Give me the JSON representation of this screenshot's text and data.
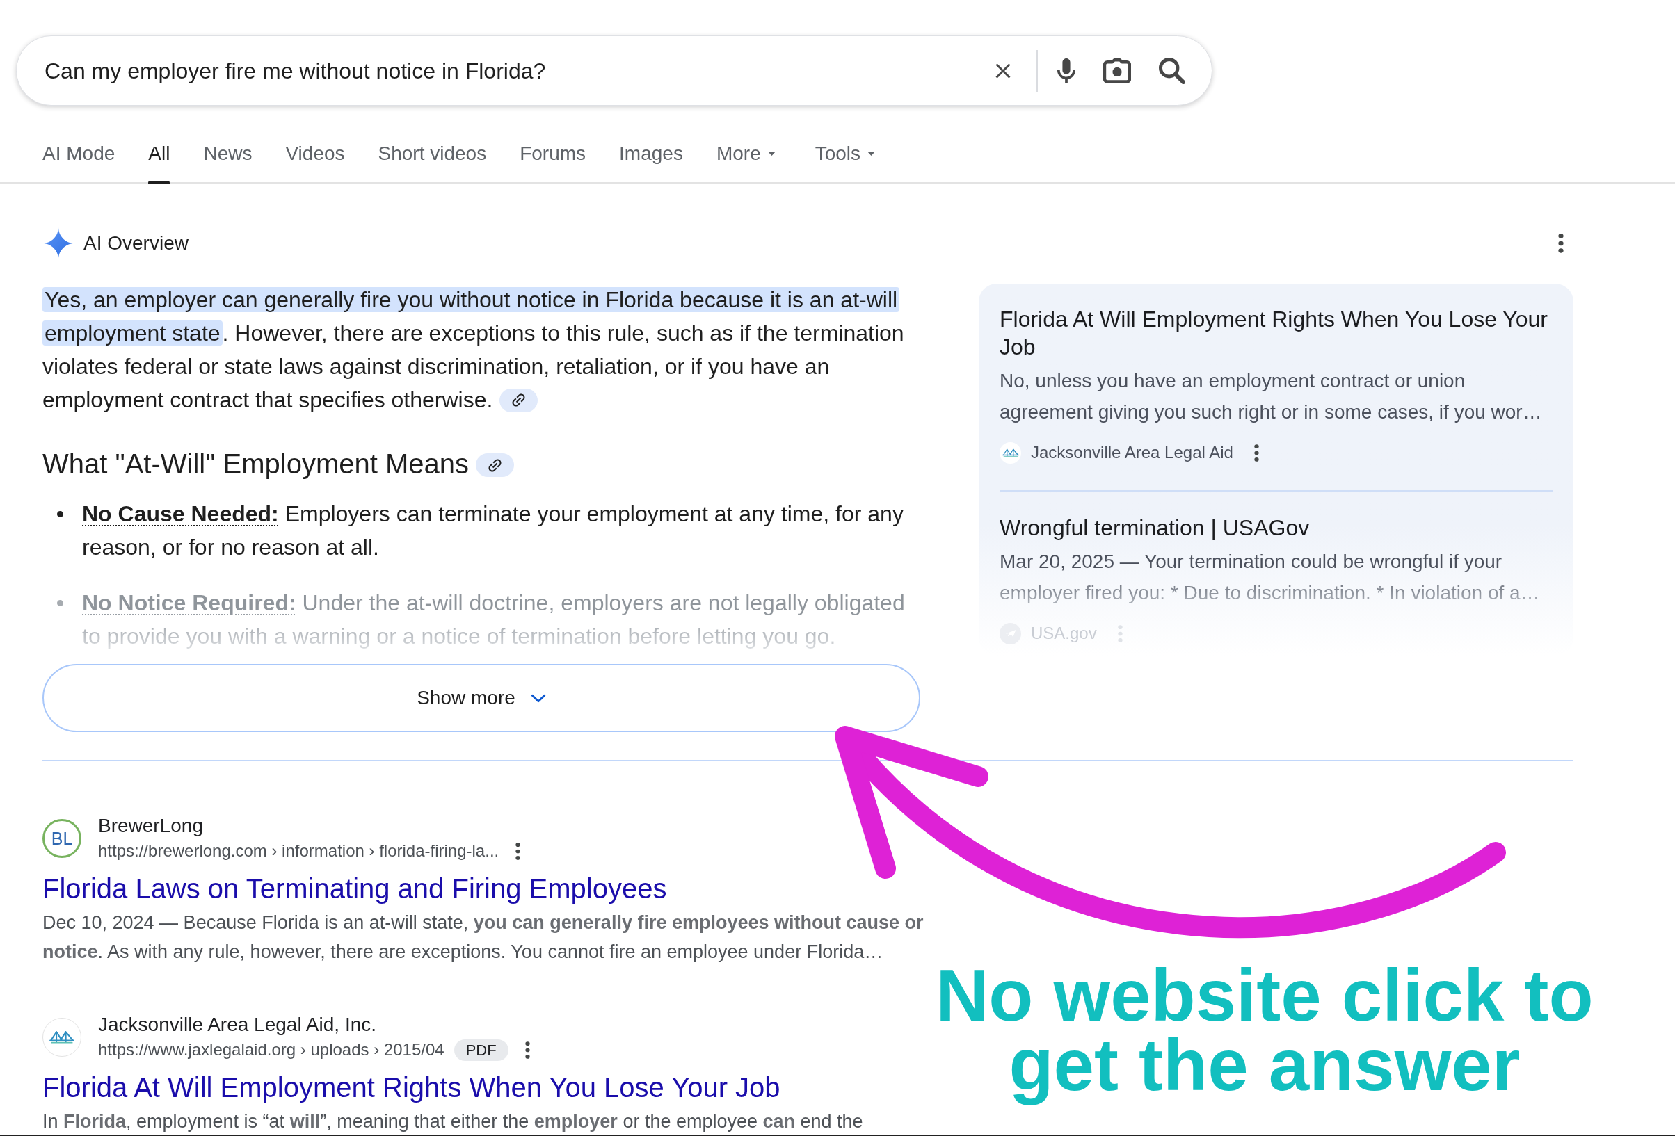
{
  "search": {
    "value": "Can my employer fire me without notice in Florida?"
  },
  "tabs": [
    {
      "label": "AI Mode",
      "selected": false,
      "dropdown": false
    },
    {
      "label": "All",
      "selected": true,
      "dropdown": false
    },
    {
      "label": "News",
      "selected": false,
      "dropdown": false
    },
    {
      "label": "Videos",
      "selected": false,
      "dropdown": false
    },
    {
      "label": "Short videos",
      "selected": false,
      "dropdown": false
    },
    {
      "label": "Forums",
      "selected": false,
      "dropdown": false
    },
    {
      "label": "Images",
      "selected": false,
      "dropdown": false
    },
    {
      "label": "More",
      "selected": false,
      "dropdown": true
    }
  ],
  "tools": {
    "label": "Tools",
    "dropdown": true
  },
  "ai_overview": {
    "title": "AI Overview",
    "summary": [
      {
        "text": "Yes, an employer can generally fire you without notice in Florida because it is an at-will employment state",
        "highlighted": true
      },
      {
        "text": ". However, there are exceptions to this rule, such as if the termination violates federal or state laws against discrimination, retaliation, or if you have an employment contract that specifies otherwise.",
        "highlighted": false
      }
    ],
    "heading": "What \"At-Will\" Employment Means",
    "bullets": [
      {
        "label": "No Cause Needed:",
        "text": "Employers can terminate your employment at any time, for any reason, or for no reason at all.",
        "faded": false
      },
      {
        "label": "No Notice Required:",
        "text": "Under the at-will doctrine, employers are not legally obligated to provide you with a warning or a notice of termination before letting you go.",
        "faded": true
      }
    ],
    "show_more": "Show more",
    "sources": [
      {
        "title": "Florida At Will Employment Rights When You Lose Your Job",
        "snippet": "No, unless you have an employment contract or union agreement giving you such right or in some cases, if you wor…",
        "site": "Jacksonville Area Legal Aid",
        "favicon": {
          "kind": "bridge"
        },
        "faded": false
      },
      {
        "title": "Wrongful termination | USAGov",
        "snippet": "Mar 20, 2025 — Your termination could be wrongful if your employer fired you: * Due to discrimination. * In violation of a…",
        "site": "USA.gov",
        "favicon": {
          "kind": "seal"
        },
        "faded": true
      }
    ]
  },
  "results": [
    {
      "site": "BrewerLong",
      "url": "https://brewerlong.com › information › florida-firing-la...",
      "favicon": {
        "kind": "monogram",
        "text": "BL"
      },
      "title": "Florida Laws on Terminating and Firing Employees",
      "snippet": "Dec 10, 2024 — Because Florida is an at-will state, **you can generally fire employees without cause or notice**. As with any rule, however, there are exceptions. You cannot fire an employee under Florida…"
    },
    {
      "site": "Jacksonville Area Legal Aid, Inc.",
      "url": "https://www.jaxlegalaid.org › uploads › 2015/04",
      "badge": "PDF",
      "favicon": {
        "kind": "bridge"
      },
      "title": "Florida At Will Employment Rights When You Lose Your Job",
      "snippet": "In **Florida**, employment is “at **will**”, meaning that either the **employer** or the employee **can** end the"
    }
  ],
  "annotation": {
    "text": "No website click to get the answer"
  }
}
